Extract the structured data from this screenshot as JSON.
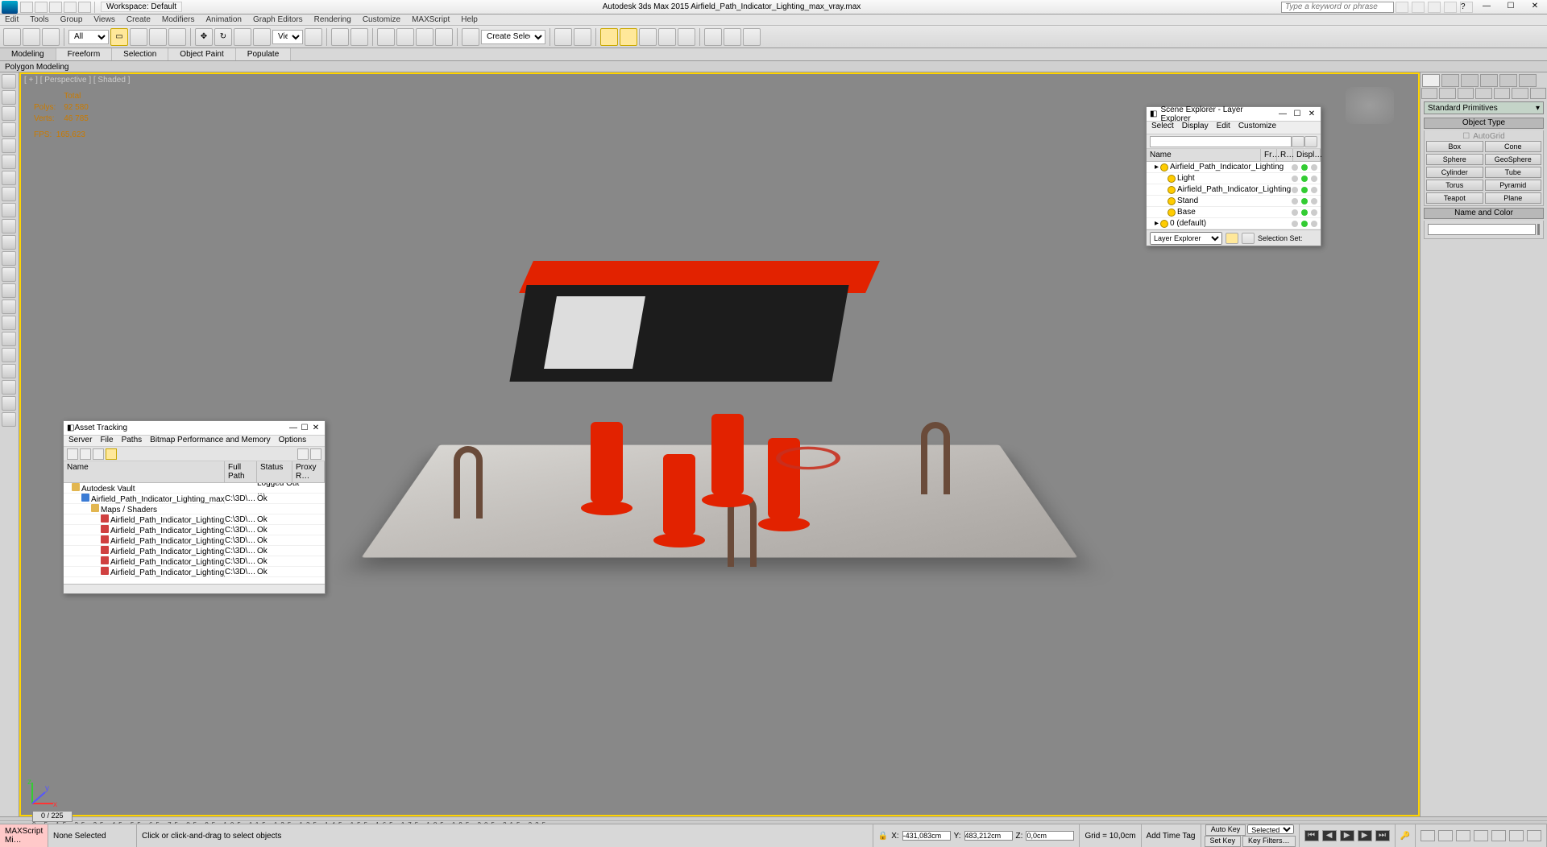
{
  "titlebar": {
    "workspace_label": "Workspace: Default",
    "app_title": "Autodesk 3ds Max  2015      Airfield_Path_Indicator_Lighting_max_vray.max",
    "search_placeholder": "Type a keyword or phrase"
  },
  "menubar": [
    "Edit",
    "Tools",
    "Group",
    "Views",
    "Create",
    "Modifiers",
    "Animation",
    "Graph Editors",
    "Rendering",
    "Customize",
    "MAXScript",
    "Help"
  ],
  "toolbar": {
    "selection_filter": "All",
    "view_label": "View",
    "named_sel_placeholder": "Create Selection Se"
  },
  "ribbon_tabs": [
    "Modeling",
    "Freeform",
    "Selection",
    "Object Paint",
    "Populate"
  ],
  "ribbon_panel": "Polygon Modeling",
  "viewport": {
    "label": "[ + ] [ Perspective ] [ Shaded ]",
    "stats": {
      "head_total": "Total",
      "polys_label": "Polys:",
      "polys_total": "92 580",
      "verts_label": "Verts:",
      "verts_total": "46 785",
      "fps_label": "FPS:",
      "fps_value": "165,623"
    }
  },
  "scene_explorer": {
    "title": "Scene Explorer - Layer Explorer",
    "menus": [
      "Select",
      "Display",
      "Edit",
      "Customize"
    ],
    "headers": [
      "Name",
      "Fr…",
      "R…",
      "Displ…"
    ],
    "rows": [
      {
        "indent": 0,
        "icon": "layer",
        "name": "Airfield_Path_Indicator_Lighting"
      },
      {
        "indent": 1,
        "icon": "light",
        "name": "Light"
      },
      {
        "indent": 1,
        "icon": "obj",
        "name": "Airfield_Path_Indicator_Lighting"
      },
      {
        "indent": 1,
        "icon": "obj",
        "name": "Stand"
      },
      {
        "indent": 1,
        "icon": "obj",
        "name": "Base"
      },
      {
        "indent": 0,
        "icon": "layer",
        "name": "0 (default)"
      }
    ],
    "footer_mode": "Layer Explorer",
    "footer_label": "Selection Set:"
  },
  "asset_tracking": {
    "title": "Asset Tracking",
    "menus": [
      "Server",
      "File",
      "Paths",
      "Bitmap Performance and Memory",
      "Options"
    ],
    "headers": {
      "name": "Name",
      "path": "Full Path",
      "status": "Status",
      "proxy": "Proxy R…"
    },
    "rows": [
      {
        "indent": 10,
        "icon": "folder",
        "name": "Autodesk Vault",
        "path": "",
        "status": "Logged Out …"
      },
      {
        "indent": 22,
        "icon": "max",
        "name": "Airfield_Path_Indicator_Lighting_max_vray.max",
        "path": "C:\\3D\\…",
        "status": "Ok"
      },
      {
        "indent": 34,
        "icon": "folder",
        "name": "Maps / Shaders",
        "path": "",
        "status": ""
      },
      {
        "indent": 46,
        "icon": "img",
        "name": "Airfield_Path_Indicator_Lighting_Diffuse.png",
        "path": "C:\\3D\\…",
        "status": "Ok"
      },
      {
        "indent": 46,
        "icon": "img",
        "name": "Airfield_Path_Indicator_Lighting_Fresnel.png",
        "path": "C:\\3D\\…",
        "status": "Ok"
      },
      {
        "indent": 46,
        "icon": "img",
        "name": "Airfield_Path_Indicator_Lighting_Glossiness.png",
        "path": "C:\\3D\\…",
        "status": "Ok"
      },
      {
        "indent": 46,
        "icon": "img",
        "name": "Airfield_Path_Indicator_Lighting_Normal.png",
        "path": "C:\\3D\\…",
        "status": "Ok"
      },
      {
        "indent": 46,
        "icon": "img",
        "name": "Airfield_Path_Indicator_Lighting_Refraction.png",
        "path": "C:\\3D\\…",
        "status": "Ok"
      },
      {
        "indent": 46,
        "icon": "img",
        "name": "Airfield_Path_Indicator_Lighting_Specular.png",
        "path": "C:\\3D\\…",
        "status": "Ok"
      }
    ]
  },
  "command_panel": {
    "category": "Standard Primitives",
    "rollout_object_type": "Object Type",
    "autogrid": "AutoGrid",
    "buttons": [
      "Box",
      "Cone",
      "Sphere",
      "GeoSphere",
      "Cylinder",
      "Tube",
      "Torus",
      "Pyramid",
      "Teapot",
      "Plane"
    ],
    "rollout_name_color": "Name and Color"
  },
  "status": {
    "slider_text": "0 / 225",
    "none_selected": "None Selected",
    "maxscript_label": "MAXScript Mi…",
    "prompt": "Click or click-and-drag to select objects",
    "x_label": "X:",
    "x_val": "-431,083cm",
    "y_label": "Y:",
    "y_val": "483,212cm",
    "z_label": "Z:",
    "z_val": "0,0cm",
    "grid_label": "Grid = 10,0cm",
    "autokey": "Auto Key",
    "selected": "Selected",
    "setkey": "Set Key",
    "keyfilters": "Key Filters…",
    "addtag": "Add Time Tag"
  }
}
